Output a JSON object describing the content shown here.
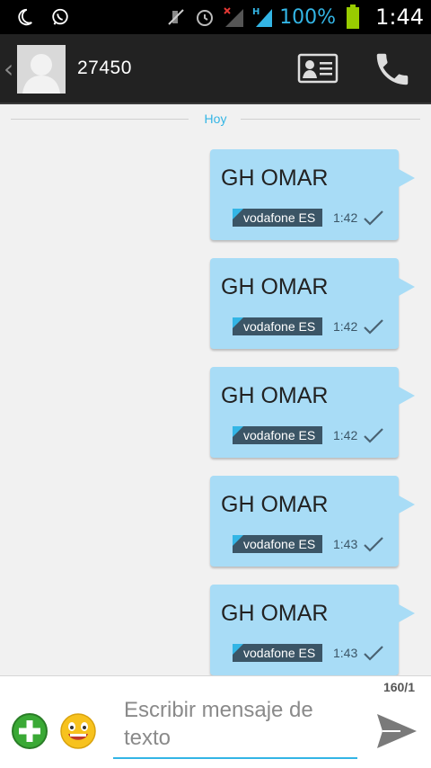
{
  "status_bar": {
    "battery_percent": "100%",
    "time": "1:44"
  },
  "action_bar": {
    "contact_name": "27450"
  },
  "conversation": {
    "day_label": "Hoy",
    "messages": [
      {
        "text": "GH OMAR",
        "carrier": "vodafone ES",
        "time": "1:42"
      },
      {
        "text": "GH OMAR",
        "carrier": "vodafone ES",
        "time": "1:42"
      },
      {
        "text": "GH OMAR",
        "carrier": "vodafone ES",
        "time": "1:42"
      },
      {
        "text": "GH OMAR",
        "carrier": "vodafone ES",
        "time": "1:43"
      },
      {
        "text": "GH OMAR",
        "carrier": "vodafone ES",
        "time": "1:43"
      }
    ]
  },
  "compose": {
    "char_counter": "160/1",
    "placeholder": "Escribir mensaje de texto"
  },
  "colors": {
    "accent": "#33b5e5",
    "bubble": "#a8dcf6",
    "carrier_tag": "#3b5566",
    "action_bar": "#222222",
    "battery": "#99cc00"
  },
  "icons": {
    "status_left": [
      "moon-icon",
      "whatsapp-icon"
    ],
    "status_right": [
      "mute-icon",
      "alarm-icon",
      "no-signal-icon",
      "hspa-signal-icon",
      "battery-icon"
    ],
    "action_bar": [
      "back-chevron-icon",
      "contact-card-icon",
      "phone-icon"
    ],
    "message": [
      "delivered-check-icon"
    ],
    "compose": [
      "add-attachment-icon",
      "smiley-icon",
      "send-icon"
    ]
  }
}
